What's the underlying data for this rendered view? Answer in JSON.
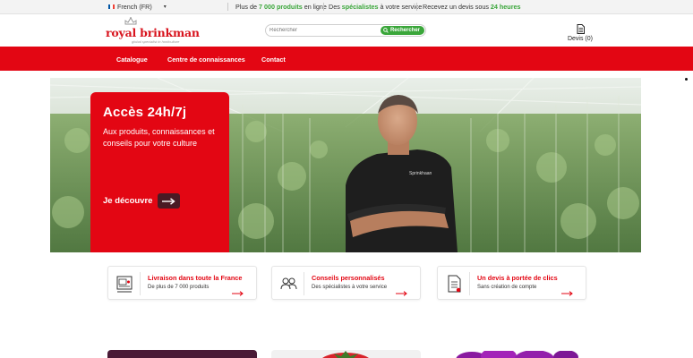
{
  "topbar": {
    "language": "French (FR)",
    "flag_colors": [
      "#0055a4",
      "#ffffff",
      "#ef4135"
    ],
    "usp1_pre": "Plus de ",
    "usp1_highlight": "7 000 produits",
    "usp1_post": " en ligne",
    "usp2_pre": "Des ",
    "usp2_highlight": "spécialistes",
    "usp2_post": " à votre service",
    "usp3_pre": "Recevez un devis sous ",
    "usp3_highlight": "24 heures"
  },
  "header": {
    "logo_text": "royal brinkman",
    "logo_tagline": "global specialist in horticulture",
    "search_placeholder": "Rechercher",
    "search_button": "Rechercher",
    "quote_label": "Devis (0)"
  },
  "nav": {
    "items": [
      "Catalogue",
      "Centre de connaissances",
      "Contact"
    ]
  },
  "hero": {
    "title": "Accès 24h/7j",
    "subtitle": "Aux produits, connaissances et conseils pour votre culture",
    "cta": "Je découvre",
    "shirt_text": "Sprinkhaan"
  },
  "features": [
    {
      "title": "Livraison dans toute la France",
      "subtitle": "De plus de 7 000 produits",
      "icon": "truck-icon"
    },
    {
      "title": "Conseils personnalisés",
      "subtitle": "Des spécialistes à votre service",
      "icon": "users-icon"
    },
    {
      "title": "Un devis à portée de clics",
      "subtitle": "Sans création de compte",
      "icon": "document-icon"
    }
  ],
  "colors": {
    "brand_red": "#e30613",
    "accent_green": "#3aa63a",
    "cta_dark": "#4a1a24"
  }
}
